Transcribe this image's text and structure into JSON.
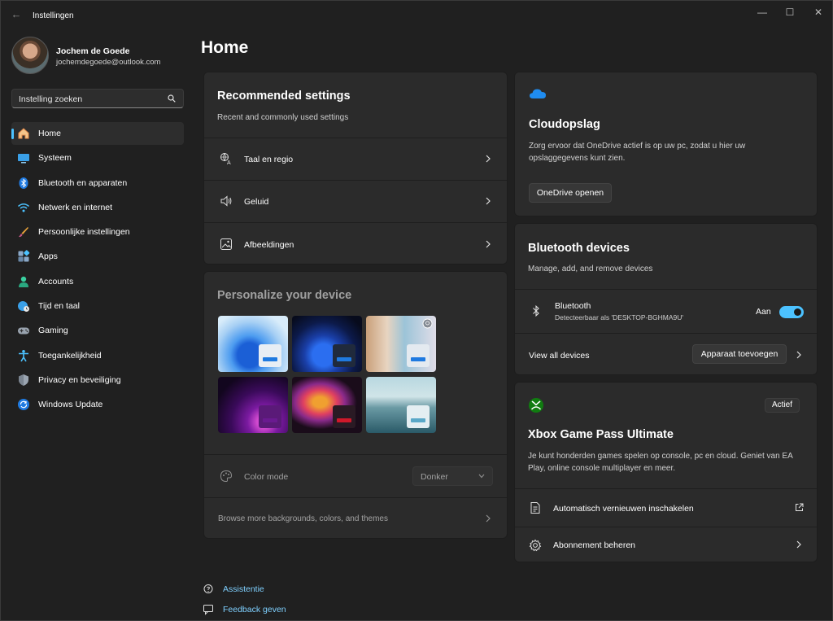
{
  "window": {
    "title": "Instellingen",
    "back_glyph": "←",
    "minimize_glyph": "—",
    "maximize_glyph": "☐",
    "close_glyph": "✕"
  },
  "profile": {
    "name": "Jochem de Goede",
    "email": "jochemdegoede@outlook.com"
  },
  "search": {
    "placeholder": "Instelling zoeken"
  },
  "sidebar": {
    "items": [
      {
        "label": "Home",
        "icon": "home-icon",
        "active": true
      },
      {
        "label": "Systeem",
        "icon": "system-icon"
      },
      {
        "label": "Bluetooth en apparaten",
        "icon": "bluetooth-icon"
      },
      {
        "label": "Netwerk en internet",
        "icon": "wifi-icon"
      },
      {
        "label": "Persoonlijke instellingen",
        "icon": "brush-icon"
      },
      {
        "label": "Apps",
        "icon": "apps-icon"
      },
      {
        "label": "Accounts",
        "icon": "account-icon"
      },
      {
        "label": "Tijd en taal",
        "icon": "globe-clock-icon"
      },
      {
        "label": "Gaming",
        "icon": "gamepad-icon"
      },
      {
        "label": "Toegankelijkheid",
        "icon": "accessibility-icon"
      },
      {
        "label": "Privacy en beveiliging",
        "icon": "shield-icon"
      },
      {
        "label": "Windows Update",
        "icon": "update-icon"
      }
    ]
  },
  "main": {
    "title": "Home",
    "recommended": {
      "title": "Recommended settings",
      "subtitle": "Recent and commonly used settings",
      "rows": [
        {
          "label": "Taal en regio",
          "icon": "language-icon"
        },
        {
          "label": "Geluid",
          "icon": "speaker-icon"
        },
        {
          "label": "Afbeeldingen",
          "icon": "image-icon"
        }
      ]
    },
    "personalize": {
      "title": "Personalize your device",
      "color_mode_label": "Color mode",
      "color_mode_value": "Donker",
      "browse_label": "Browse more backgrounds, colors, and themes"
    },
    "cloud": {
      "title": "Cloudopslag",
      "description": "Zorg ervoor dat OneDrive actief is op uw pc, zodat u hier uw opslaggegevens kunt zien.",
      "button": "OneDrive openen"
    },
    "bluetooth": {
      "title": "Bluetooth devices",
      "subtitle": "Manage, add, and remove devices",
      "device_label": "Bluetooth",
      "device_sub": "Detecteerbaar als 'DESKTOP-BGHMA9U'",
      "toggle_state": "Aan",
      "view_all": "View all devices",
      "add_button": "Apparaat toevoegen"
    },
    "xbox": {
      "badge": "Actief",
      "title": "Xbox Game Pass Ultimate",
      "description": "Je kunt honderden games spelen op console, pc en cloud. Geniet van EA Play, online console multiplayer en meer.",
      "rows": [
        {
          "label": "Automatisch vernieuwen inschakelen"
        },
        {
          "label": "Abonnement beheren"
        }
      ]
    }
  },
  "footer": {
    "help": "Assistentie",
    "feedback": "Feedback geven"
  },
  "colors": {
    "accent": "#4cc2ff",
    "background": "#202020",
    "card": "#2b2b2b",
    "xbox_green": "#107c10"
  }
}
